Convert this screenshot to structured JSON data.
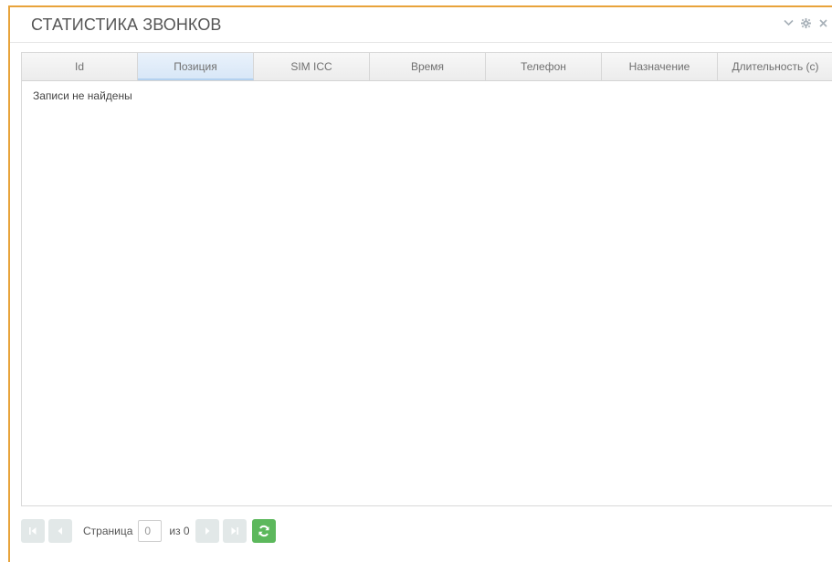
{
  "widget": {
    "title": "СТАТИСТИКА ЗВОНКОВ",
    "tools": [
      "chevron-down-icon",
      "gear-icon",
      "close-icon"
    ]
  },
  "table": {
    "columns": [
      "Id",
      "Позиция",
      "SIM ICC",
      "Время",
      "Телефон",
      "Назначение",
      "Длительность (с)"
    ],
    "active_column": "Позиция",
    "empty_text": "Записи не найдены",
    "rows": []
  },
  "pager": {
    "page_label": "Страница",
    "page_value": "0",
    "of_label": "из 0"
  },
  "colors": {
    "frame_accent": "#e8a33b",
    "refresh": "#5cb85c",
    "pager_button": "#dde4e4"
  }
}
